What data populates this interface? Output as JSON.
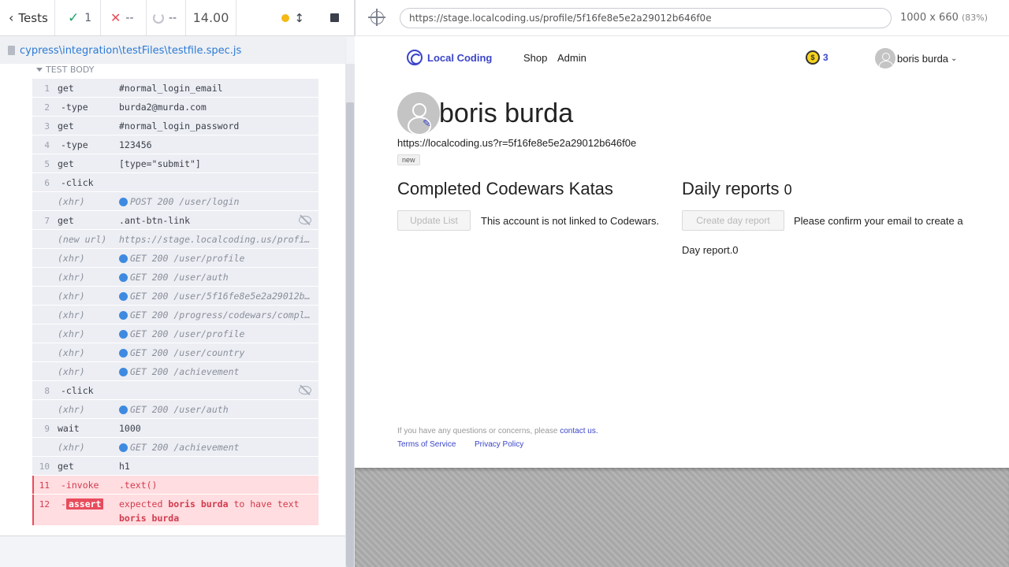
{
  "reporter": {
    "back_label": "Tests",
    "passed": "1",
    "failed": "--",
    "pending": "--",
    "duration": "14.00",
    "spec_path": "cypress\\integration\\testFiles\\testfile.spec.js",
    "section_label": "TEST BODY",
    "colors": {
      "pass": "#1fa36b",
      "fail": "#e84c5c",
      "xhr_dot": "#3f8ae0",
      "link": "#2c7ad6"
    }
  },
  "commands": [
    {
      "num": "1",
      "name": "get",
      "msg": "#normal_login_email"
    },
    {
      "num": "2",
      "name": "-type",
      "msg": "burda2@murda.com"
    },
    {
      "num": "3",
      "name": "get",
      "msg": "#normal_login_password"
    },
    {
      "num": "4",
      "name": "-type",
      "msg": "123456"
    },
    {
      "num": "5",
      "name": "get",
      "msg": "[type=\"submit\"]"
    },
    {
      "num": "6",
      "name": "-click",
      "msg": ""
    },
    {
      "num": "",
      "name": "(xhr)",
      "msg": "POST 200 /user/login"
    },
    {
      "num": "7",
      "name": "get",
      "msg": ".ant-btn-link"
    },
    {
      "num": "",
      "name": "(new url)",
      "msg": "https://stage.localcoding.us/profile…"
    },
    {
      "num": "",
      "name": "(xhr)",
      "msg": "GET 200 /user/profile"
    },
    {
      "num": "",
      "name": "(xhr)",
      "msg": "GET 200 /user/auth"
    },
    {
      "num": "",
      "name": "(xhr)",
      "msg": "GET 200 /user/5f16fe8e5e2a29012b64…"
    },
    {
      "num": "",
      "name": "(xhr)",
      "msg": "GET 200 /progress/codewars/complet…"
    },
    {
      "num": "",
      "name": "(xhr)",
      "msg": "GET 200 /user/profile"
    },
    {
      "num": "",
      "name": "(xhr)",
      "msg": "GET 200 /user/country"
    },
    {
      "num": "",
      "name": "(xhr)",
      "msg": "GET 200 /achievement"
    },
    {
      "num": "8",
      "name": "-click",
      "msg": ""
    },
    {
      "num": "",
      "name": "(xhr)",
      "msg": "GET 200 /user/auth"
    },
    {
      "num": "9",
      "name": "wait",
      "msg": "1000"
    },
    {
      "num": "",
      "name": "(xhr)",
      "msg": "GET 200 /achievement"
    },
    {
      "num": "10",
      "name": "get",
      "msg": "h1"
    },
    {
      "num": "11",
      "name": "-invoke",
      "msg": ".text()"
    },
    {
      "num": "12",
      "name_prefix": "-",
      "name": "assert",
      "msg_pre": "expected",
      "msg_val1": "boris burda",
      "msg_mid": "to have text",
      "msg_val2": "boris burda"
    }
  ],
  "aut": {
    "url": "https://stage.localcoding.us/profile/5f16fe8e5e2a29012b646f0e",
    "viewport": "1000 x 660",
    "zoom": "(83%)"
  },
  "site": {
    "brand": "Local Coding",
    "nav": {
      "shop": "Shop",
      "admin": "Admin"
    },
    "coins": "3",
    "coin_symbol": "$",
    "user_menu_name": "boris burda",
    "profile_name": "boris burda",
    "referral_link": "https://localcoding.us?r=5f16fe8e5e2a29012b646f0e",
    "tag": "new",
    "katas": {
      "title": "Completed Codewars Katas",
      "button": "Update List",
      "message": "This account is not linked to Codewars."
    },
    "reports": {
      "title": "Daily reports",
      "count": "0",
      "button": "Create day report",
      "message": "Please confirm your email to create a",
      "message2": "Day report.0"
    },
    "footer": {
      "note": "If you have any questions or concerns, please",
      "contact": "contact us.",
      "terms": "Terms of Service",
      "privacy": "Privacy Policy"
    },
    "colors": {
      "brand": "#3b45c9"
    }
  }
}
